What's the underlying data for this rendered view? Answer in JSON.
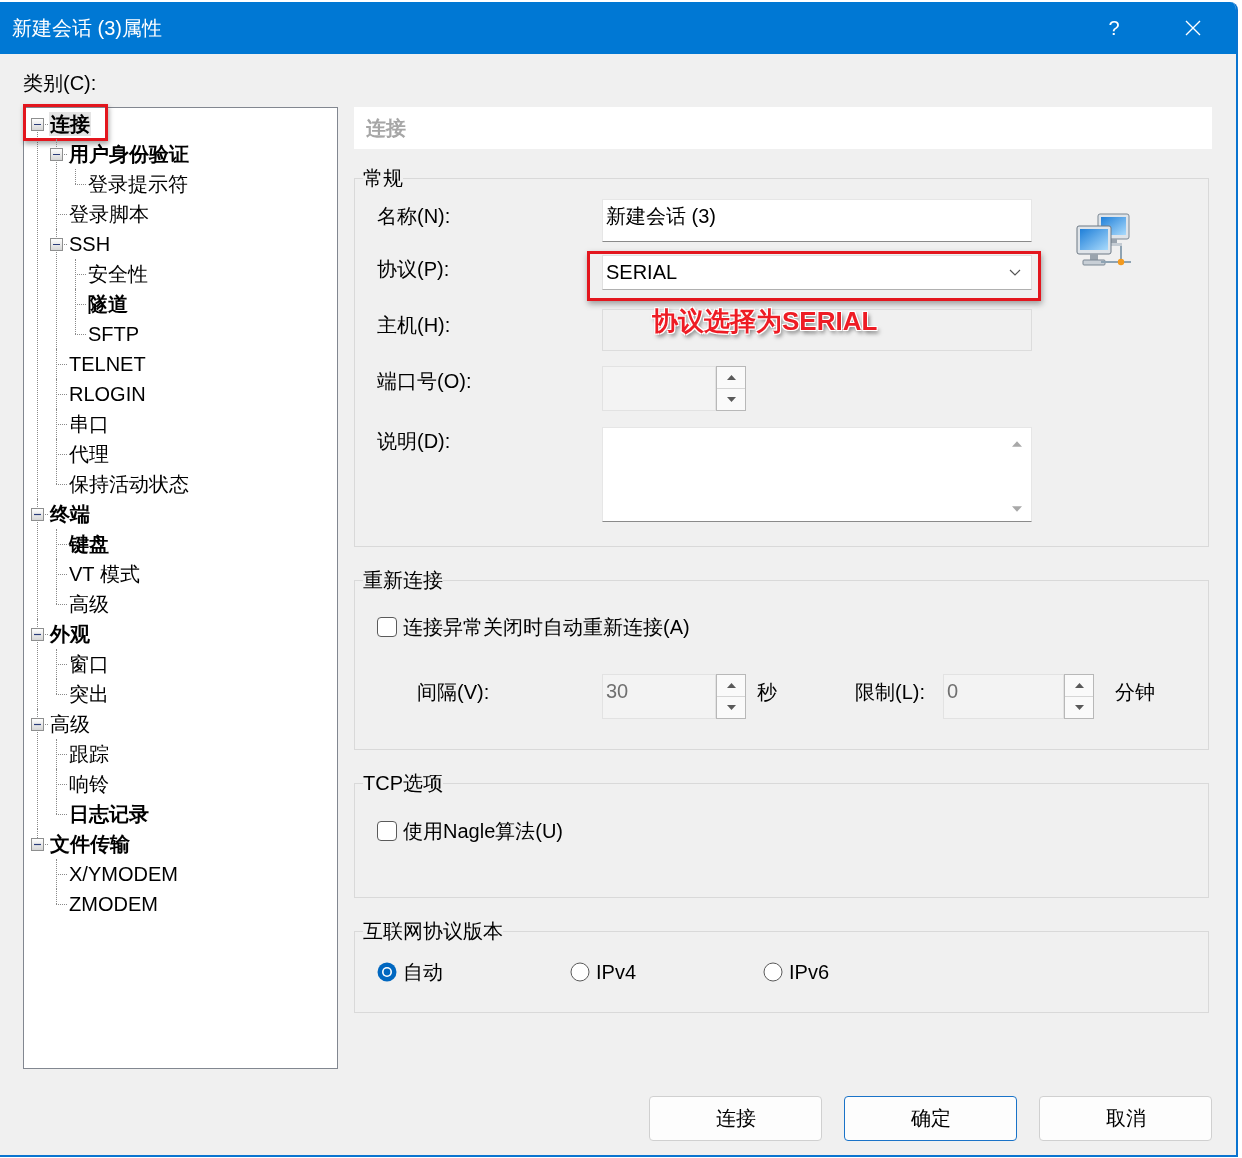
{
  "window": {
    "title": "新建会话 (3)属性",
    "help": "?"
  },
  "category_label": "类别(C):",
  "tree": [
    {
      "label": "连接",
      "selected": true,
      "emphasized": true,
      "highlighted": true,
      "expanded": true,
      "children": [
        {
          "label": "用户身份验证",
          "selected": false,
          "emphasized": true,
          "highlighted": false,
          "expanded": true,
          "children": [
            {
              "label": "登录提示符",
              "selected": false,
              "emphasized": false,
              "highlighted": false
            }
          ]
        },
        {
          "label": "登录脚本",
          "selected": false,
          "emphasized": false,
          "highlighted": false
        },
        {
          "label": "SSH",
          "selected": false,
          "emphasized": false,
          "highlighted": false,
          "expanded": true,
          "children": [
            {
              "label": "安全性",
              "selected": false,
              "emphasized": false,
              "highlighted": false
            },
            {
              "label": "隧道",
              "selected": false,
              "emphasized": true,
              "highlighted": false
            },
            {
              "label": "SFTP",
              "selected": false,
              "emphasized": false,
              "highlighted": false
            }
          ]
        },
        {
          "label": "TELNET",
          "selected": false,
          "emphasized": false,
          "highlighted": false
        },
        {
          "label": "RLOGIN",
          "selected": false,
          "emphasized": false,
          "highlighted": false
        },
        {
          "label": "串口",
          "selected": false,
          "emphasized": false,
          "highlighted": false
        },
        {
          "label": "代理",
          "selected": false,
          "emphasized": false,
          "highlighted": false
        },
        {
          "label": "保持活动状态",
          "selected": false,
          "emphasized": false,
          "highlighted": false
        }
      ]
    },
    {
      "label": "终端",
      "selected": false,
      "emphasized": true,
      "highlighted": false,
      "expanded": true,
      "children": [
        {
          "label": "键盘",
          "selected": false,
          "emphasized": true,
          "highlighted": false
        },
        {
          "label": "VT 模式",
          "selected": false,
          "emphasized": false,
          "highlighted": false
        },
        {
          "label": "高级",
          "selected": false,
          "emphasized": false,
          "highlighted": false
        }
      ]
    },
    {
      "label": "外观",
      "selected": false,
      "emphasized": true,
      "highlighted": false,
      "expanded": true,
      "children": [
        {
          "label": "窗口",
          "selected": false,
          "emphasized": false,
          "highlighted": false
        },
        {
          "label": "突出",
          "selected": false,
          "emphasized": false,
          "highlighted": false
        }
      ]
    },
    {
      "label": "高级",
      "selected": false,
      "emphasized": false,
      "highlighted": false,
      "expanded": true,
      "children": [
        {
          "label": "跟踪",
          "selected": false,
          "emphasized": false,
          "highlighted": false
        },
        {
          "label": "响铃",
          "selected": false,
          "emphasized": false,
          "highlighted": false
        },
        {
          "label": "日志记录",
          "selected": false,
          "emphasized": true,
          "highlighted": false
        }
      ]
    },
    {
      "label": "文件传输",
      "selected": false,
      "emphasized": true,
      "highlighted": false,
      "expanded": true,
      "children": [
        {
          "label": "X/YMODEM",
          "selected": false,
          "emphasized": false,
          "highlighted": false
        },
        {
          "label": "ZMODEM",
          "selected": false,
          "emphasized": false,
          "highlighted": false
        }
      ]
    }
  ],
  "page_header": "连接",
  "general": {
    "title": "常规",
    "name": {
      "label": "名称(N):",
      "value": "新建会话 (3)"
    },
    "protocol": {
      "label": "协议(P):",
      "value": "SERIAL",
      "highlighted": true
    },
    "host": {
      "label": "主机(H):",
      "disabled": true
    },
    "port": {
      "label": "端口号(O):",
      "disabled": true
    },
    "description": {
      "label": "说明(D):"
    }
  },
  "annotation": {
    "text": "协议选择为SERIAL"
  },
  "reconnect": {
    "title": "重新连接",
    "auto": {
      "label": "连接异常关闭时自动重新连接(A)",
      "checked": false
    },
    "interval": {
      "label": "间隔(V):",
      "value": "30",
      "unit": "秒",
      "disabled": true
    },
    "limit": {
      "label": "限制(L):",
      "value": "0",
      "unit": "分钟",
      "disabled": true
    }
  },
  "tcp": {
    "title": "TCP选项",
    "nagle": {
      "label": "使用Nagle算法(U)",
      "checked": false
    }
  },
  "ip_version": {
    "title": "互联网协议版本",
    "options": [
      {
        "label": "自动",
        "selected": true
      },
      {
        "label": "IPv4",
        "selected": false
      },
      {
        "label": "IPv6",
        "selected": false
      }
    ]
  },
  "buttons": [
    {
      "label": "连接",
      "default": false
    },
    {
      "label": "确定",
      "default": true
    },
    {
      "label": "取消",
      "default": false
    }
  ]
}
